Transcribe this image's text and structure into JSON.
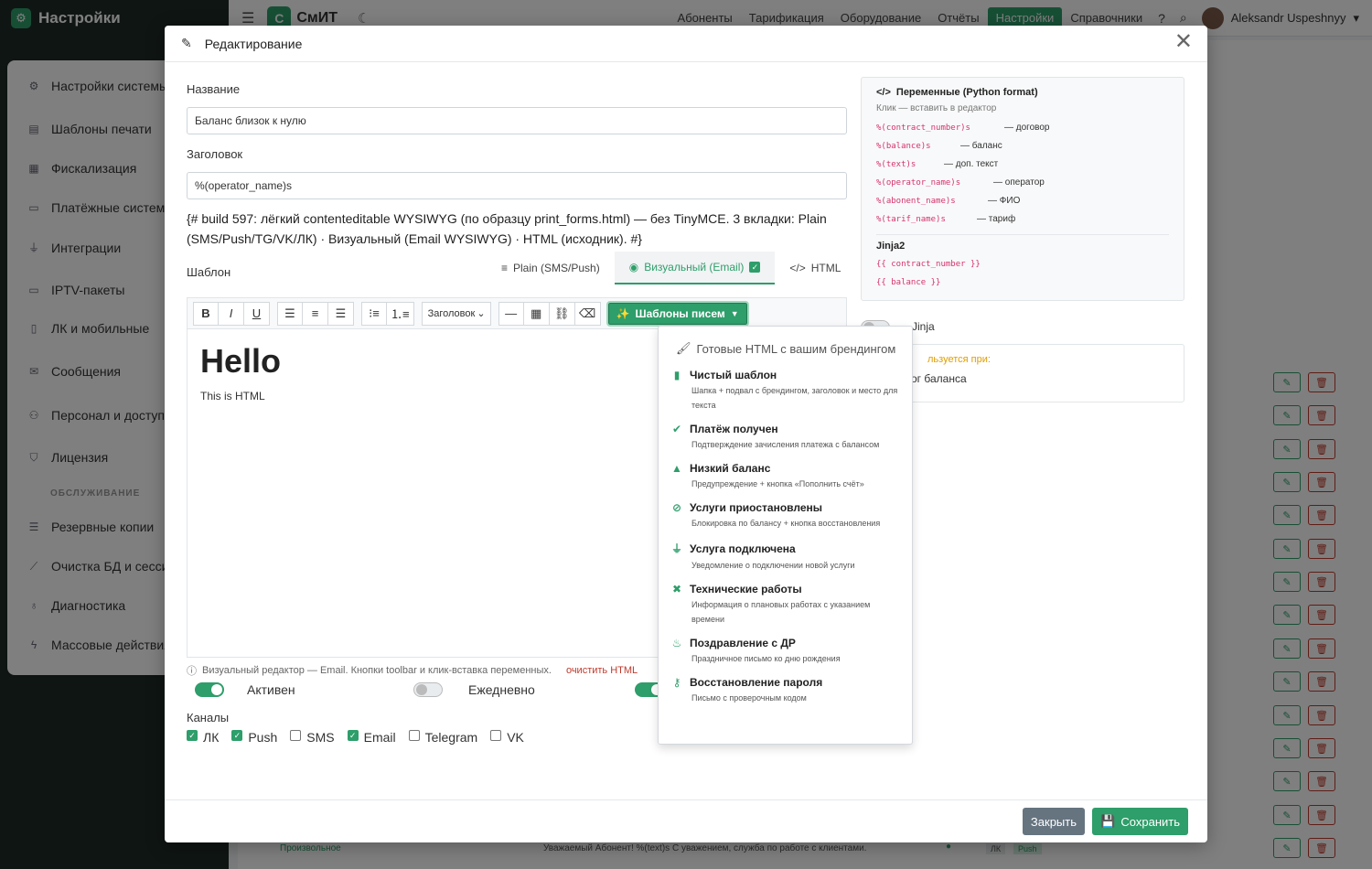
{
  "app": {
    "section_title": "Настройки",
    "brand": "СмИТ",
    "brand_letter": "С",
    "nav": [
      "Абоненты",
      "Тарификация",
      "Оборудование",
      "Отчёты",
      "Настройки",
      "Справочники"
    ],
    "nav_active": "Настройки",
    "user": "Aleksandr Uspeshnyy"
  },
  "sidebar": {
    "items": [
      "Настройки системы",
      "Шаблоны печати",
      "Фискализация",
      "Платёжные системы",
      "Интеграции",
      "IPTV-пакеты",
      "ЛК и мобильные",
      "Сообщения",
      "Персонал и доступ",
      "Лицензия"
    ],
    "section_label": "ОБСЛУЖИВАНИЕ",
    "items2": [
      "Резервные копии",
      "Очистка БД и сессий",
      "Диагностика",
      "Массовые действия"
    ]
  },
  "bg_row": {
    "name": "Произвольное",
    "text": "Уважаемый Абонент! %(text)s С уважением, служба по работе с клиентами.",
    "tags": [
      "ЛК",
      "Push"
    ]
  },
  "modal": {
    "title": "Редактирование",
    "name_label": "Название",
    "name_value": "Баланс близок к нулю",
    "header_label": "Заголовок",
    "header_value": "%(operator_name)s",
    "comment": "{# build 597: лёгкий contenteditable WYSIWYG (по образцу print_forms.html) — без TinyMCE. 3 вкладки: Plain (SMS/Push/TG/VK/ЛК) · Визуальный (Email WYSIWYG) · HTML (исходник). #}",
    "template_label": "Шаблон",
    "tabs": [
      "Plain (SMS/Push)",
      "Визуальный (Email)",
      "HTML"
    ],
    "toolbar": {
      "bold": "B",
      "italic": "I",
      "underline": "U",
      "heading_select": "Заголовок",
      "templates_button": "Шаблоны писем"
    },
    "editor": {
      "heading": "Hello",
      "body": "This is HTML"
    },
    "hint": "Визуальный редактор — Email. Кнопки toolbar и клик-вставка переменных.",
    "clear_link": "очистить HTML",
    "toggles": {
      "active": "Активен",
      "daily": "Ежедневно"
    },
    "channels_label": "Каналы",
    "channels": [
      {
        "label": "ЛК",
        "checked": true
      },
      {
        "label": "Push",
        "checked": true
      },
      {
        "label": "SMS",
        "checked": false
      },
      {
        "label": "Email",
        "checked": true
      },
      {
        "label": "Telegram",
        "checked": false
      },
      {
        "label": "VK",
        "checked": false
      }
    ],
    "footer": {
      "close": "Закрыть",
      "save": "Сохранить"
    }
  },
  "variables": {
    "title": "Переменные (Python format)",
    "subtitle": "Клик — вставить в редактор",
    "items": [
      {
        "code": "%(contract_number)s",
        "desc": "— договор"
      },
      {
        "code": "%(balance)s",
        "desc": "— баланс"
      },
      {
        "code": "%(text)s",
        "desc": "— доп. текст"
      },
      {
        "code": "%(operator_name)s",
        "desc": "— оператор"
      },
      {
        "code": "%(abonent_name)s",
        "desc": "— ФИО"
      },
      {
        "code": "%(tarif_name)s",
        "desc": "— тариф"
      }
    ],
    "jinja_title": "Jinja2",
    "jinja_items": [
      "{{ contract_number }}",
      "{{ balance }}"
    ],
    "jinja_toggle_label": "Jinja",
    "used_label": "льзуется при:",
    "used_value": "ог баланса"
  },
  "dropdown": {
    "header": "Готовые HTML с вашим брендингом",
    "items": [
      {
        "title": "Чистый шаблон",
        "desc": "Шапка + подвал с брендингом, заголовок и место для текста",
        "icon": "file-icon"
      },
      {
        "title": "Платёж получен",
        "desc": "Подтверждение зачисления платежа с балансом",
        "icon": "check-circle-icon"
      },
      {
        "title": "Низкий баланс",
        "desc": "Предупреждение + кнопка «Пополнить счёт»",
        "icon": "warning-icon"
      },
      {
        "title": "Услуги приостановлены",
        "desc": "Блокировка по балансу + кнопка восстановления",
        "icon": "ban-icon"
      },
      {
        "title": "Услуга подключена",
        "desc": "Уведомление о подключении новой услуги",
        "icon": "plug-icon"
      },
      {
        "title": "Технические работы",
        "desc": "Информация о плановых работах с указанием времени",
        "icon": "tools-icon"
      },
      {
        "title": "Поздравление с ДР",
        "desc": "Праздничное письмо ко дню рождения",
        "icon": "cake-icon"
      },
      {
        "title": "Восстановление пароля",
        "desc": "Письмо с проверочным кодом",
        "icon": "key-icon"
      }
    ]
  },
  "colors": {
    "accent": "#2e9e6a",
    "danger": "#c0392b",
    "code": "#d6336c"
  }
}
